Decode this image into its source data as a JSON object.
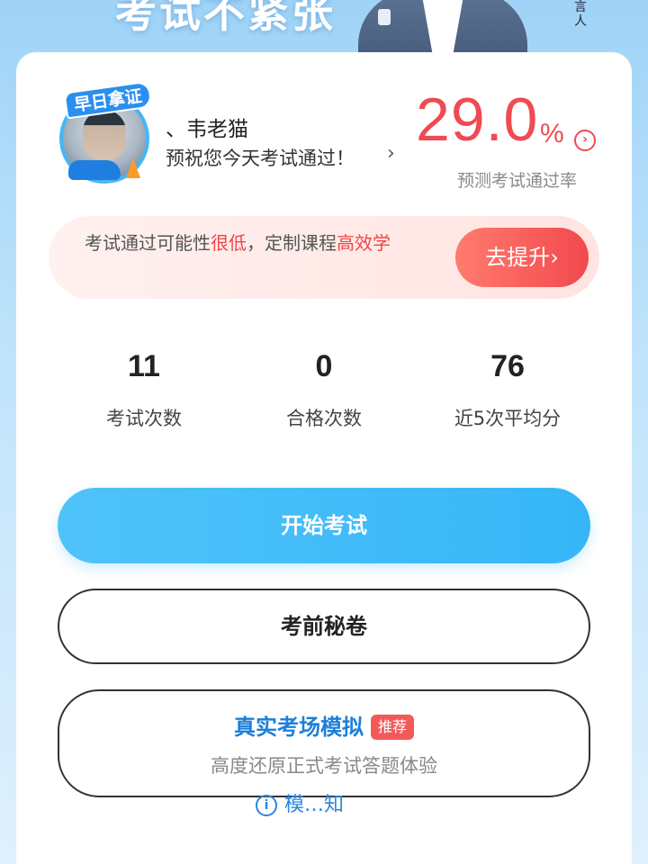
{
  "banner": {
    "slogan": "考试不紧张",
    "role_label": "言人"
  },
  "profile": {
    "badge": "早日拿证",
    "name": "、韦老猫",
    "wish": "预祝您今天考试通过！",
    "wish_chevron": "›"
  },
  "pass_rate": {
    "value": "29.0",
    "unit": "%",
    "caption": "预测考试通过率",
    "chevron": "›"
  },
  "warning": {
    "text_prefix": "考试通过可能性",
    "level": "很低",
    "text_mid": "，定制课程",
    "highlight": "高效学",
    "button": "去提升"
  },
  "stats": [
    {
      "value": "11",
      "label": "考试次数"
    },
    {
      "value": "0",
      "label": "合格次数"
    },
    {
      "value": "76",
      "label": "近5次平均分"
    }
  ],
  "actions": {
    "start": "开始考试",
    "secret": "考前秘卷",
    "simulation_title": "真实考场模拟",
    "simulation_badge": "推荐",
    "simulation_subtitle": "高度还原正式考试答题体验"
  },
  "notice": {
    "icon": "info-icon",
    "text": "模…知"
  },
  "colors": {
    "accent_red": "#f04a52",
    "accent_blue": "#36b6f7",
    "link_blue": "#2a86e0"
  }
}
